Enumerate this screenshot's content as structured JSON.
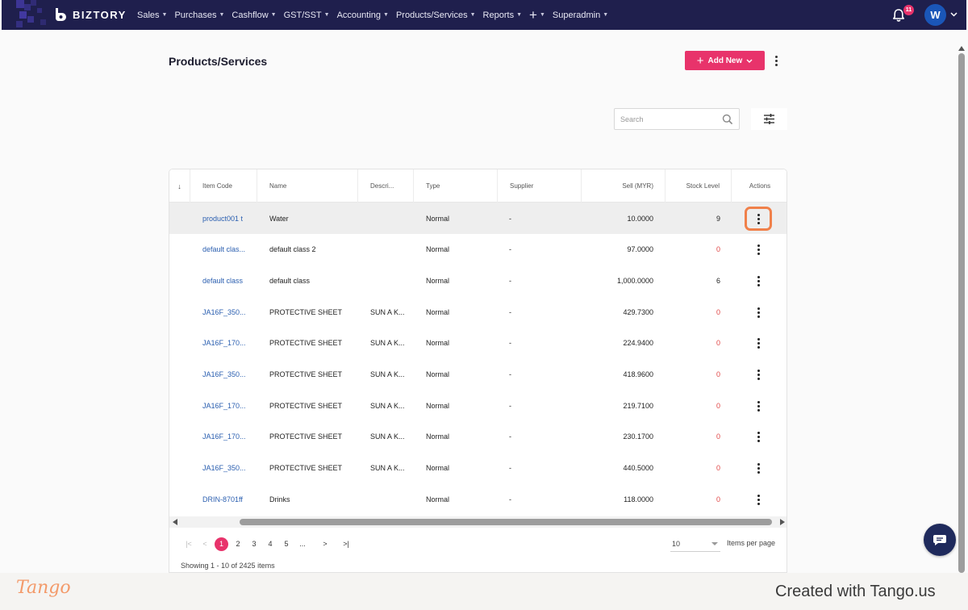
{
  "app": {
    "brand": "BIZTORY",
    "colors": {
      "nav_bg": "#1f1f4d",
      "accent": "#e8336b",
      "link": "#2b5fb0",
      "zero_stock": "#e04646",
      "highlight": "#f0804a"
    }
  },
  "nav": {
    "menu": [
      "Sales",
      "Purchases",
      "Cashflow",
      "GST/SST",
      "Accounting",
      "Products/Services",
      "Reports"
    ],
    "plus_glyph": "+",
    "superadmin": "Superadmin",
    "notification_count": "11",
    "avatar_initial": "W"
  },
  "page": {
    "title": "Products/Services",
    "add_new_label": "Add New",
    "search_placeholder": "Search"
  },
  "table": {
    "sort_glyph": "↓",
    "columns": [
      "Item Code",
      "Name",
      "Descri...",
      "Type",
      "Supplier",
      "Sell (MYR)",
      "Stock Level",
      "Actions"
    ],
    "rows": [
      {
        "code": "product001 t",
        "name": "Water",
        "desc": "",
        "type": "Normal",
        "supplier": "-",
        "sell": "10.0000",
        "stock": "9"
      },
      {
        "code": "default clas...",
        "name": "default class 2",
        "desc": "",
        "type": "Normal",
        "supplier": "-",
        "sell": "97.0000",
        "stock": "0"
      },
      {
        "code": "default class",
        "name": "default class",
        "desc": "",
        "type": "Normal",
        "supplier": "-",
        "sell": "1,000.0000",
        "stock": "6"
      },
      {
        "code": "JA16F_350...",
        "name": "PROTECTIVE SHEET",
        "desc": "SUN A K...",
        "type": "Normal",
        "supplier": "-",
        "sell": "429.7300",
        "stock": "0"
      },
      {
        "code": "JA16F_170...",
        "name": "PROTECTIVE SHEET",
        "desc": "SUN A K...",
        "type": "Normal",
        "supplier": "-",
        "sell": "224.9400",
        "stock": "0"
      },
      {
        "code": "JA16F_350...",
        "name": "PROTECTIVE SHEET",
        "desc": "SUN A K...",
        "type": "Normal",
        "supplier": "-",
        "sell": "418.9600",
        "stock": "0"
      },
      {
        "code": "JA16F_170...",
        "name": "PROTECTIVE SHEET",
        "desc": "SUN A K...",
        "type": "Normal",
        "supplier": "-",
        "sell": "219.7100",
        "stock": "0"
      },
      {
        "code": "JA16F_170...",
        "name": "PROTECTIVE SHEET",
        "desc": "SUN A K...",
        "type": "Normal",
        "supplier": "-",
        "sell": "230.1700",
        "stock": "0"
      },
      {
        "code": "JA16F_350...",
        "name": "PROTECTIVE SHEET",
        "desc": "SUN A K...",
        "type": "Normal",
        "supplier": "-",
        "sell": "440.5000",
        "stock": "0"
      },
      {
        "code": "DRIN-8701ff",
        "name": "Drinks",
        "desc": "",
        "type": "Normal",
        "supplier": "-",
        "sell": "118.0000",
        "stock": "0"
      }
    ]
  },
  "pagination": {
    "first_glyph": "|<",
    "prev_glyph": "<",
    "pages": [
      "1",
      "2",
      "3",
      "4",
      "5"
    ],
    "current": "1",
    "ellipsis": "...",
    "next_glyph": ">",
    "last_glyph": ">|",
    "per_page_value": "10",
    "per_page_label": "Items per page",
    "showing": "Showing 1 - 10 of 2425 items"
  },
  "footer": {
    "tango_logo": "Tango",
    "credit": "Created with Tango.us"
  }
}
